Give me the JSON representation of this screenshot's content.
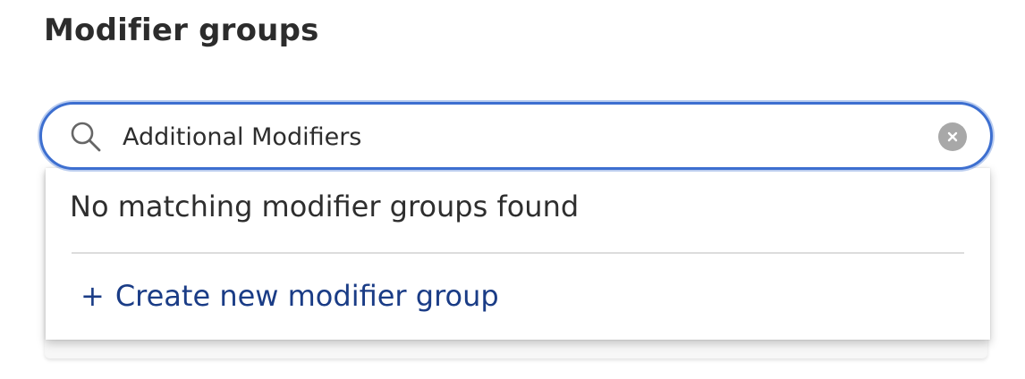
{
  "section": {
    "title": "Modifier groups"
  },
  "search": {
    "value": "Additional Modifiers",
    "placeholder": "",
    "icon": "search-icon",
    "clear_icon": "close-icon",
    "focus_color": "#3d6fd0"
  },
  "dropdown": {
    "empty_message": "No matching modifier groups found",
    "create_prefix": "+",
    "create_label": "Create new modifier group",
    "link_color": "#1a3c86"
  }
}
